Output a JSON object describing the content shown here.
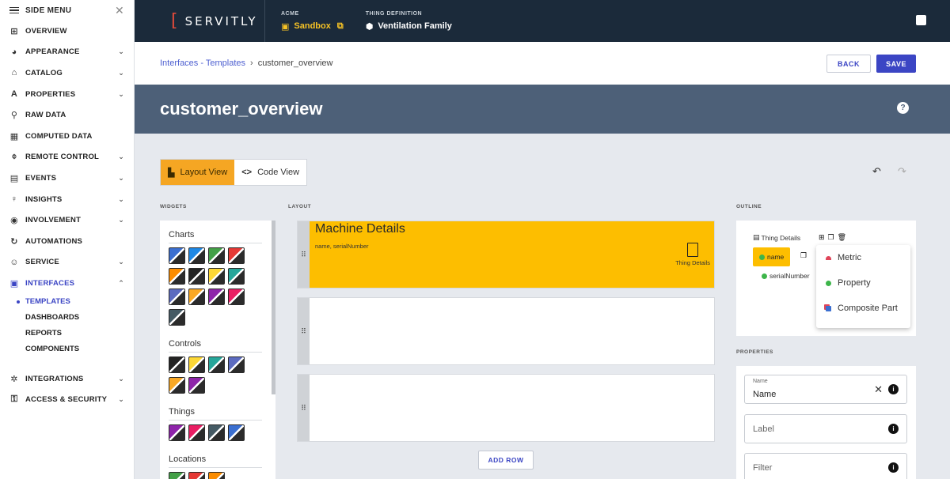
{
  "side_menu": {
    "title": "SIDE MENU",
    "items": [
      {
        "label": "OVERVIEW",
        "icon": "grid-icon",
        "glyph": "⊞",
        "chevron": ""
      },
      {
        "label": "APPEARANCE",
        "icon": "palette-icon",
        "glyph": "◕",
        "chevron": "⌄"
      },
      {
        "label": "CATALOG",
        "icon": "shapes-icon",
        "glyph": "⌂",
        "chevron": "⌄"
      },
      {
        "label": "PROPERTIES",
        "icon": "property-icon",
        "glyph": "A",
        "chevron": "⌄"
      },
      {
        "label": "RAW DATA",
        "icon": "raw-data-icon",
        "glyph": "⚲",
        "chevron": ""
      },
      {
        "label": "COMPUTED DATA",
        "icon": "computed-icon",
        "glyph": "▦",
        "chevron": ""
      },
      {
        "label": "REMOTE CONTROL",
        "icon": "remote-icon",
        "glyph": "⌽",
        "chevron": "⌄"
      },
      {
        "label": "EVENTS",
        "icon": "calendar-icon",
        "glyph": "▤",
        "chevron": "⌄"
      },
      {
        "label": "INSIGHTS",
        "icon": "bulb-icon",
        "glyph": "♀",
        "chevron": "⌄"
      },
      {
        "label": "INVOLVEMENT",
        "icon": "involvement-icon",
        "glyph": "◉",
        "chevron": "⌄"
      },
      {
        "label": "AUTOMATIONS",
        "icon": "automation-icon",
        "glyph": "↻",
        "chevron": ""
      },
      {
        "label": "SERVICE",
        "icon": "service-icon",
        "glyph": "☺",
        "chevron": "⌄"
      },
      {
        "label": "INTERFACES",
        "icon": "interfaces-icon",
        "glyph": "▣",
        "chevron": "⌃"
      }
    ],
    "interfaces_sub": [
      "TEMPLATES",
      "DASHBOARDS",
      "REPORTS",
      "COMPONENTS"
    ],
    "bottom_items": [
      {
        "label": "INTEGRATIONS",
        "icon": "integrations-icon",
        "glyph": "✲",
        "chevron": "⌄"
      },
      {
        "label": "ACCESS & SECURITY",
        "icon": "lock-icon",
        "glyph": "⚿",
        "chevron": "⌄"
      }
    ]
  },
  "topbar": {
    "logo": "SERVITLY",
    "account_caption": "ACME",
    "account_value": "Sandbox",
    "thing_caption": "THING DEFINITION",
    "thing_value": "Ventilation Family"
  },
  "breadcrumb": {
    "link": "Interfaces - Templates",
    "current": "customer_overview"
  },
  "actions": {
    "back": "BACK",
    "save": "SAVE"
  },
  "page_title": "customer_overview",
  "view_toggle": {
    "layout": "Layout View",
    "code": "Code View"
  },
  "sections": {
    "widgets": "WIDGETS",
    "layout": "LAYOUT",
    "outline": "OUTLINE",
    "properties": "PROPERTIES"
  },
  "widgets": {
    "groups": [
      {
        "name": "Charts",
        "icons": [
          "bar-chart-icon",
          "value-icon",
          "heatmap-icon",
          "table-alert-icon",
          "pie-chart-icon",
          "radar-icon",
          "gauge-icon",
          "scatter-icon",
          "donut-icon",
          "timeline-icon",
          "table-chart-icon",
          "column-chart-icon",
          "matrix-icon"
        ]
      },
      {
        "name": "Controls",
        "icons": [
          "control-gear-icon",
          "sliders-icon",
          "number-input-icon",
          "filter-list-icon",
          "form-icon",
          "filter-icon"
        ]
      },
      {
        "name": "Things",
        "icons": [
          "thing-details-icon",
          "thing-grid-icon",
          "thing-list-icon",
          "map-pin-icon"
        ]
      },
      {
        "name": "Locations",
        "icons": [
          "location-list-icon",
          "location-details-icon",
          "weather-icon"
        ]
      }
    ]
  },
  "layout": {
    "rows": [
      {
        "title": "Machine Details",
        "subtitle": "name, serialNumber",
        "widget": "Thing Details"
      }
    ],
    "add_row": "ADD ROW"
  },
  "outline": {
    "root": "Thing Details",
    "selected": "name",
    "child": "serialNumber",
    "menu": [
      "Metric",
      "Property",
      "Composite Part"
    ]
  },
  "properties": {
    "name_label": "Name",
    "name_value": "Name",
    "label_placeholder": "Label",
    "filter_placeholder": "Filter"
  },
  "colors": {
    "accent": "#3b45c4",
    "highlight": "#fdbe00",
    "topbar": "#1b2a3a",
    "title_band": "#4d6078"
  }
}
